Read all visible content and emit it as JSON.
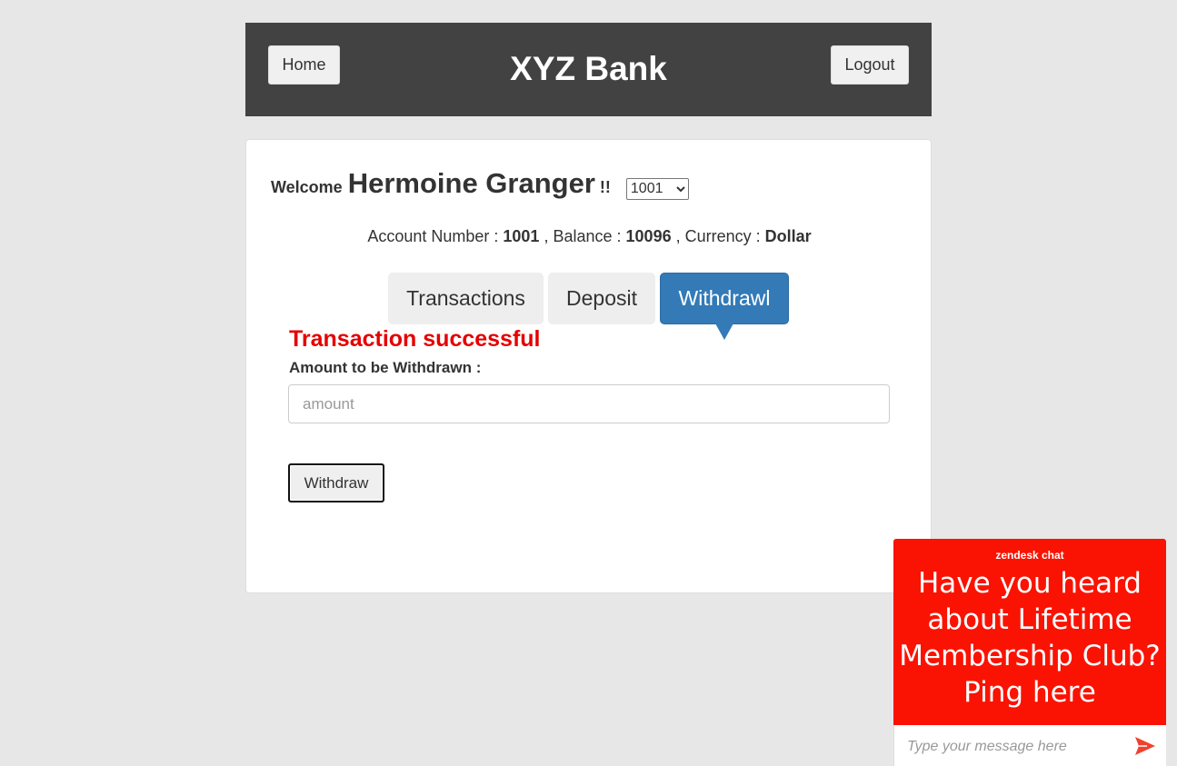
{
  "header": {
    "home_label": "Home",
    "title": "XYZ Bank",
    "logout_label": "Logout"
  },
  "customer": {
    "welcome_label": "Welcome",
    "name": "Hermoine Granger",
    "exclaim": "!!",
    "account_select": {
      "selected": "1001",
      "options": [
        "1001"
      ]
    }
  },
  "account_info": {
    "number_label": "Account Number :",
    "number": "1001",
    "balance_label": ", Balance :",
    "balance": "10096",
    "currency_label": ", Currency :",
    "currency": "Dollar"
  },
  "tabs": [
    {
      "label": "Transactions",
      "active": false
    },
    {
      "label": "Deposit",
      "active": false
    },
    {
      "label": "Withdrawl",
      "active": true
    }
  ],
  "withdraw_form": {
    "message": "Transaction successful",
    "amount_label": "Amount to be Withdrawn :",
    "amount_placeholder": "amount",
    "amount_value": "",
    "submit_label": "Withdraw"
  },
  "chat_widget": {
    "brand": "zendesk chat",
    "message": "Have you heard about Lifetime Membership Club? Ping here",
    "input_placeholder": "Type your message here",
    "send_icon": "send-arrow-icon"
  },
  "colors": {
    "background": "#e7e7e7",
    "header": "#424242",
    "active_tab": "#337ab7",
    "success_text": "#e50000",
    "chat_accent": "#fa1303"
  }
}
